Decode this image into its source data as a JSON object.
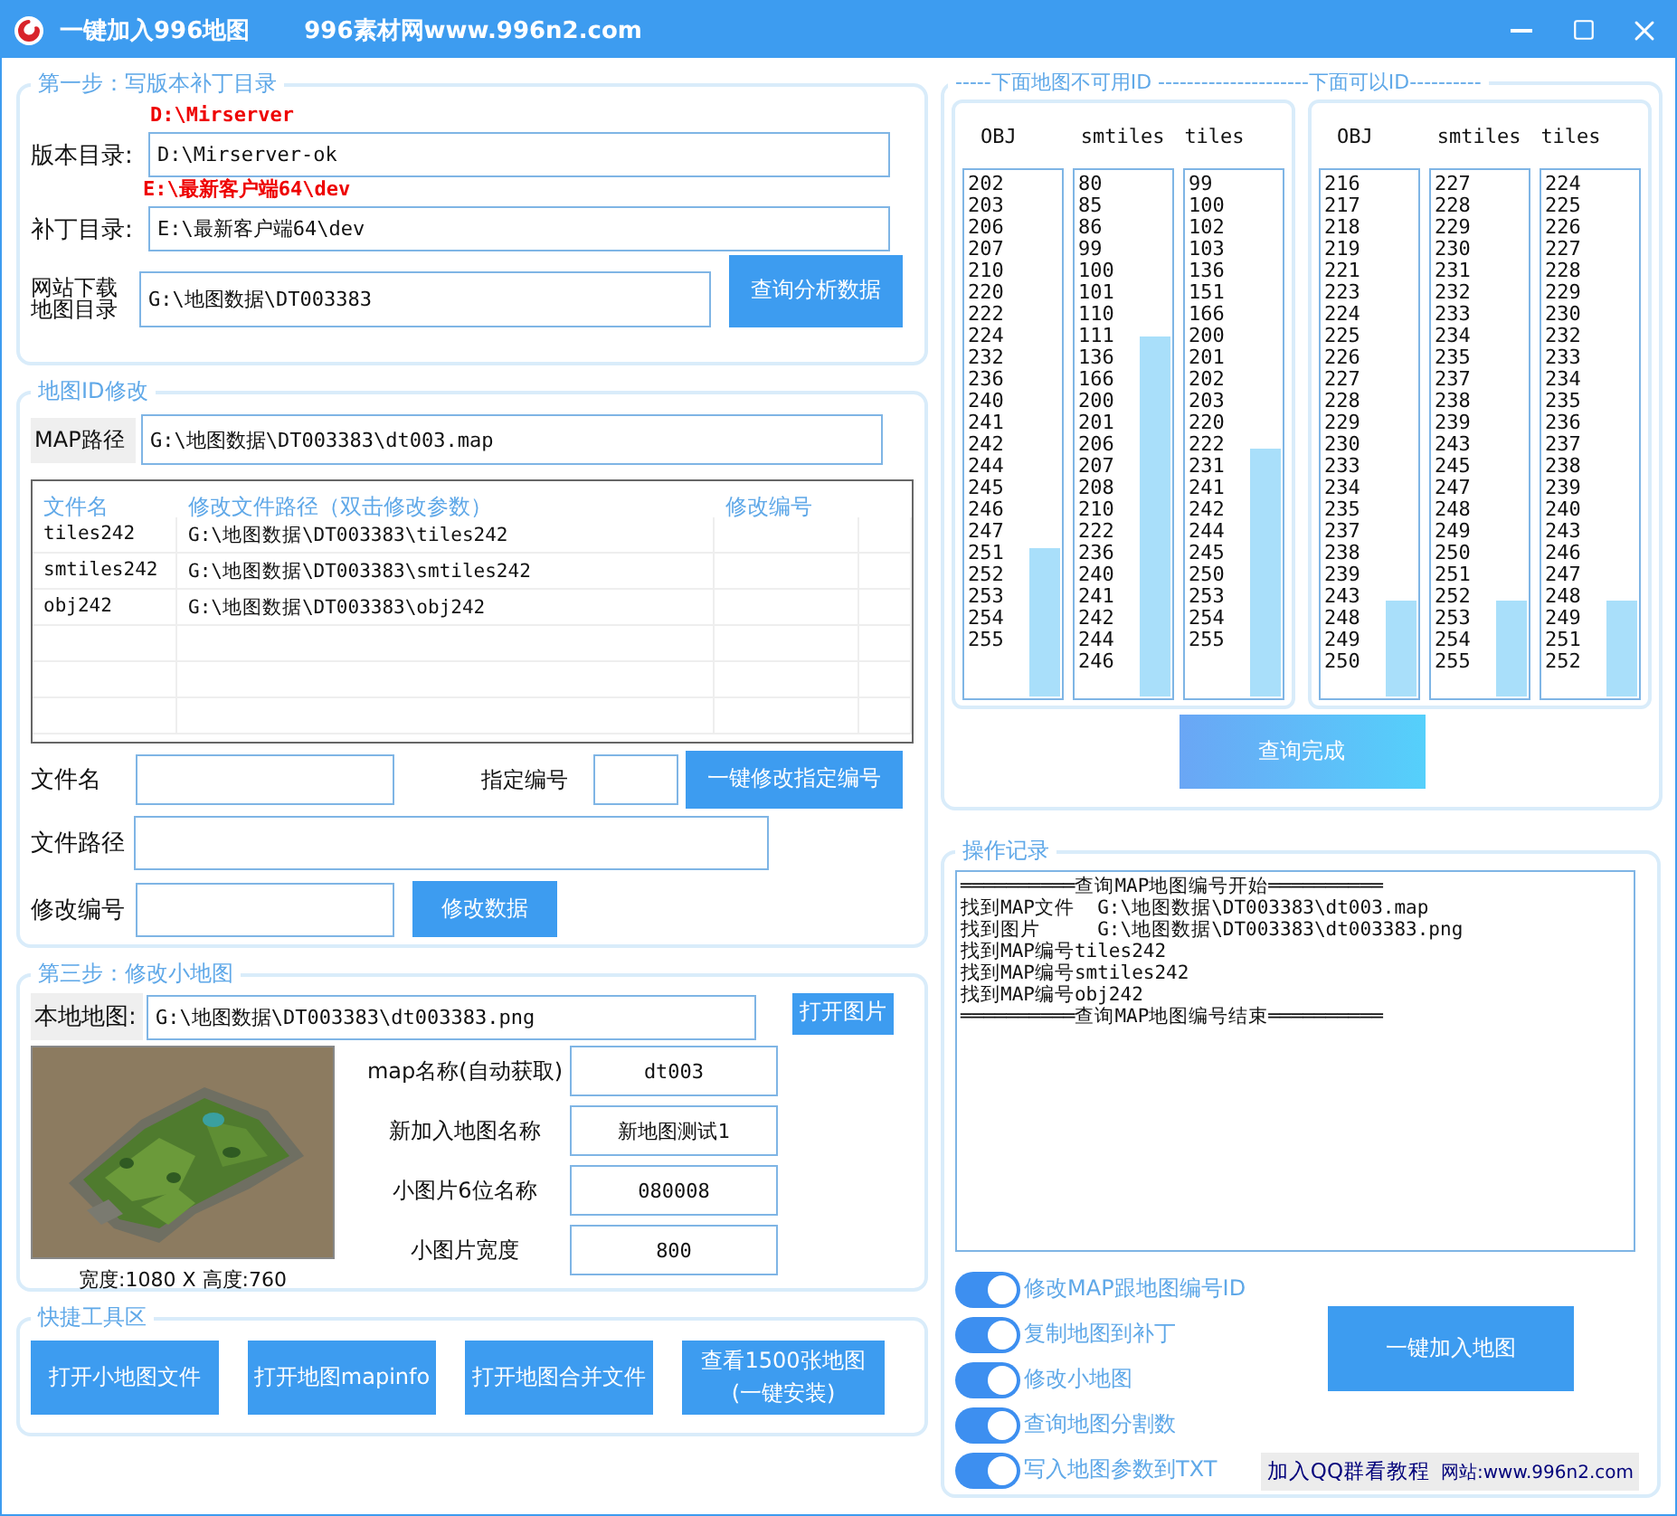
{
  "window": {
    "title": "一键加入996地图",
    "subtitle": "996素材网www.996n2.com"
  },
  "step1": {
    "legend": "第一步：写版本补丁目录",
    "fields": [
      {
        "hint": "D:\\Mirserver",
        "label": "版本目录:",
        "value": "D:\\Mirserver-ok"
      },
      {
        "hint": "E:\\最新客户端64\\dev",
        "label": "补丁目录:",
        "value": "E:\\最新客户端64\\dev"
      }
    ],
    "download": {
      "label": "网站下载地图目录",
      "value": "G:\\地图数据\\DT003383"
    },
    "button": "查询分析数据"
  },
  "step2": {
    "legend": "地图ID修改",
    "map_path": {
      "label": "MAP路径",
      "value": "G:\\地图数据\\DT003383\\dt003.map"
    },
    "table": {
      "columns": [
        "文件名",
        "修改文件路径（双击修改参数）",
        "修改编号"
      ],
      "rows": [
        {
          "cells": [
            "tiles242",
            "G:\\地图数据\\DT003383\\tiles242"
          ]
        },
        {
          "cells": [
            "smtiles242",
            "G:\\地图数据\\DT003383\\smtiles242"
          ]
        },
        {
          "cells": [
            "obj242",
            "G:\\地图数据\\DT003383\\obj242"
          ]
        }
      ]
    },
    "file_name_label": "文件名",
    "number_label": "指定编号",
    "batch_button": "一键修改指定编号",
    "file_path_label": "文件路径",
    "edit_number_label": "修改编号",
    "edit_button": "修改数据"
  },
  "step3": {
    "legend": "第三步：修改小地图",
    "local_map": {
      "label": "本地地图:",
      "value": "G:\\地图数据\\DT003383\\dt003383.png"
    },
    "open_button": "打开图片",
    "caption": "宽度:1080 X 高度:760",
    "fields": [
      {
        "label": "map名称(自动获取)",
        "value": "dt003"
      },
      {
        "label": "新加入地图名称",
        "value": "新地图测试1"
      },
      {
        "label": "小图片6位名称",
        "value": "080008"
      },
      {
        "label": "小图片宽度",
        "value": "800"
      }
    ]
  },
  "tools": {
    "legend": "快捷工具区",
    "buttons": [
      "打开小地图文件",
      "打开地图mapinfo",
      "打开地图合并文件",
      "查看1500张地图\n(一键安装)"
    ]
  },
  "ids": {
    "legend": "-----下面地图不可用ID ---------------------下面可以ID----------",
    "panels": [
      {
        "columns": [
          {
            "header": "OBJ",
            "ids": [
              "202",
              "203",
              "206",
              "207",
              "210",
              "220",
              "222",
              "224",
              "232",
              "236",
              "240",
              "241",
              "242",
              "244",
              "245",
              "246",
              "247",
              "251",
              "252",
              "253",
              "254",
              "255"
            ]
          },
          {
            "header": "smtiles",
            "ids": [
              "80",
              "85",
              "86",
              "99",
              "100",
              "101",
              "110",
              "111",
              "136",
              "166",
              "200",
              "201",
              "206",
              "207",
              "208",
              "210",
              "222",
              "236",
              "240",
              "241",
              "242",
              "244",
              "246"
            ]
          },
          {
            "header": "tiles",
            "ids": [
              "99",
              "100",
              "102",
              "103",
              "136",
              "151",
              "166",
              "200",
              "201",
              "202",
              "203",
              "220",
              "222",
              "231",
              "241",
              "242",
              "244",
              "245",
              "250",
              "253",
              "254",
              "255"
            ]
          }
        ]
      },
      {
        "columns": [
          {
            "header": "OBJ",
            "ids": [
              "216",
              "217",
              "218",
              "219",
              "221",
              "223",
              "224",
              "225",
              "226",
              "227",
              "228",
              "229",
              "230",
              "233",
              "234",
              "235",
              "237",
              "238",
              "239",
              "243",
              "248",
              "249",
              "250"
            ]
          },
          {
            "header": "smtiles",
            "ids": [
              "227",
              "228",
              "229",
              "230",
              "231",
              "232",
              "233",
              "234",
              "235",
              "237",
              "238",
              "239",
              "243",
              "245",
              "247",
              "248",
              "249",
              "250",
              "251",
              "252",
              "253",
              "254",
              "255"
            ]
          },
          {
            "header": "tiles",
            "ids": [
              "224",
              "225",
              "226",
              "227",
              "228",
              "229",
              "230",
              "232",
              "233",
              "234",
              "235",
              "236",
              "237",
              "238",
              "239",
              "240",
              "243",
              "246",
              "247",
              "248",
              "249",
              "251",
              "252"
            ]
          }
        ]
      }
    ],
    "button": "查询完成"
  },
  "log": {
    "legend": "操作记录",
    "lines": [
      "══════════查询MAP地图编号开始══════════",
      "找到MAP文件  G:\\地图数据\\DT003383\\dt003.map",
      "找到图片     G:\\地图数据\\DT003383\\dt003383.png",
      "找到MAP编号tiles242",
      "找到MAP编号smtiles242",
      "找到MAP编号obj242",
      "══════════查询MAP地图编号结束══════════"
    ],
    "toggles": [
      {
        "label": "修改MAP跟地图编号ID",
        "on": true
      },
      {
        "label": "复制地图到补丁",
        "on": true
      },
      {
        "label": "修改小地图",
        "on": true
      },
      {
        "label": "查询地图分割数",
        "on": true
      },
      {
        "label": "写入地图参数到TXT",
        "on": true
      }
    ],
    "button": "一键加入地图",
    "footer": [
      "加入QQ群看教程",
      "网站:www.996n2.com"
    ]
  }
}
